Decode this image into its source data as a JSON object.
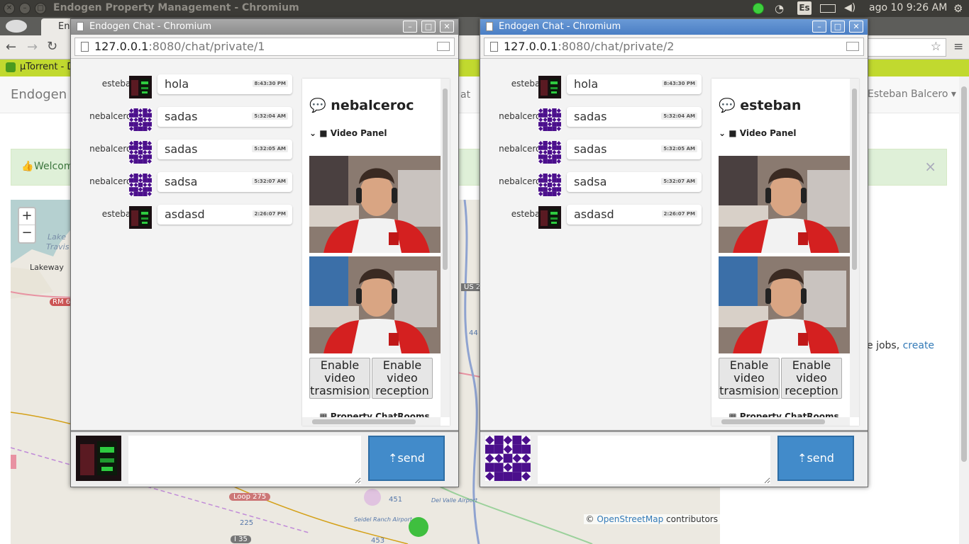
{
  "os": {
    "window_title": "Endogen Property Management - Chromium",
    "keyboard": "Es",
    "clock": "ago 10  9:26 AM"
  },
  "background": {
    "tab_label": "En",
    "bookmark": "µTorrent - D",
    "brand": "Endogen",
    "nav_partial": "at",
    "user_menu": "Esteban Balcero",
    "welcome": "Welcom",
    "close": "×",
    "right_text": "e jobs, ",
    "right_link": "create",
    "map": {
      "zoom_in": "+",
      "zoom_out": "−",
      "lake": "Lake",
      "travis": "Travis",
      "lakeway": "Lakeway",
      "rm": "RM 6",
      "us": "US 2",
      "n44": "44",
      "loop": "Loop 275",
      "n451": "451",
      "n225": "225",
      "i35": "I 35",
      "n453": "453",
      "airport1": "Del Valle Airport",
      "airport2": "Seidel Ranch Airport",
      "attrib_copy": "© ",
      "attrib_link": "OpenStreetMap",
      "attrib_rest": " contributors"
    }
  },
  "windows": [
    {
      "title": "Endogen Chat - Chromium",
      "url_host": "127.0.0.1",
      "url_rest": ":8080/chat/private/1",
      "messages": [
        {
          "user": "esteban",
          "text": "hola",
          "time": "8:43:30 PM"
        },
        {
          "user": "nebalceroc",
          "text": "sadas",
          "time": "5:32:04 AM"
        },
        {
          "user": "nebalceroc",
          "text": "sadas",
          "time": "5:32:05 AM"
        },
        {
          "user": "nebalceroc",
          "text": "sadsa",
          "time": "5:32:07 AM"
        },
        {
          "user": "esteban",
          "text": "asdasd",
          "time": "2:26:07 PM"
        }
      ],
      "panel_name": "nebalceroc",
      "video_panel": "Video Panel",
      "btn_trans": "Enable video trasmision",
      "btn_recv": "Enable video reception",
      "property_rooms": "Property ChatRooms",
      "send": "send"
    },
    {
      "title": "Endogen Chat - Chromium",
      "url_host": "127.0.0.1",
      "url_rest": ":8080/chat/private/2",
      "messages": [
        {
          "user": "esteban",
          "text": "hola",
          "time": "8:43:30 PM"
        },
        {
          "user": "nebalceroc",
          "text": "sadas",
          "time": "5:32:04 AM"
        },
        {
          "user": "nebalceroc",
          "text": "sadas",
          "time": "5:32:05 AM"
        },
        {
          "user": "nebalceroc",
          "text": "sadsa",
          "time": "5:32:07 AM"
        },
        {
          "user": "esteban",
          "text": "asdasd",
          "time": "2:26:07 PM"
        }
      ],
      "panel_name": "esteban",
      "video_panel": "Video Panel",
      "btn_trans": "Enable video trasmision",
      "btn_recv": "Enable video reception",
      "property_rooms": "Property ChatRooms",
      "send": "send"
    }
  ],
  "colors": {
    "send_button": "#428bca",
    "identicon": "#4b0f8c",
    "bookmark_bar": "#c1d92f",
    "active_title": "#4a7ec4"
  }
}
